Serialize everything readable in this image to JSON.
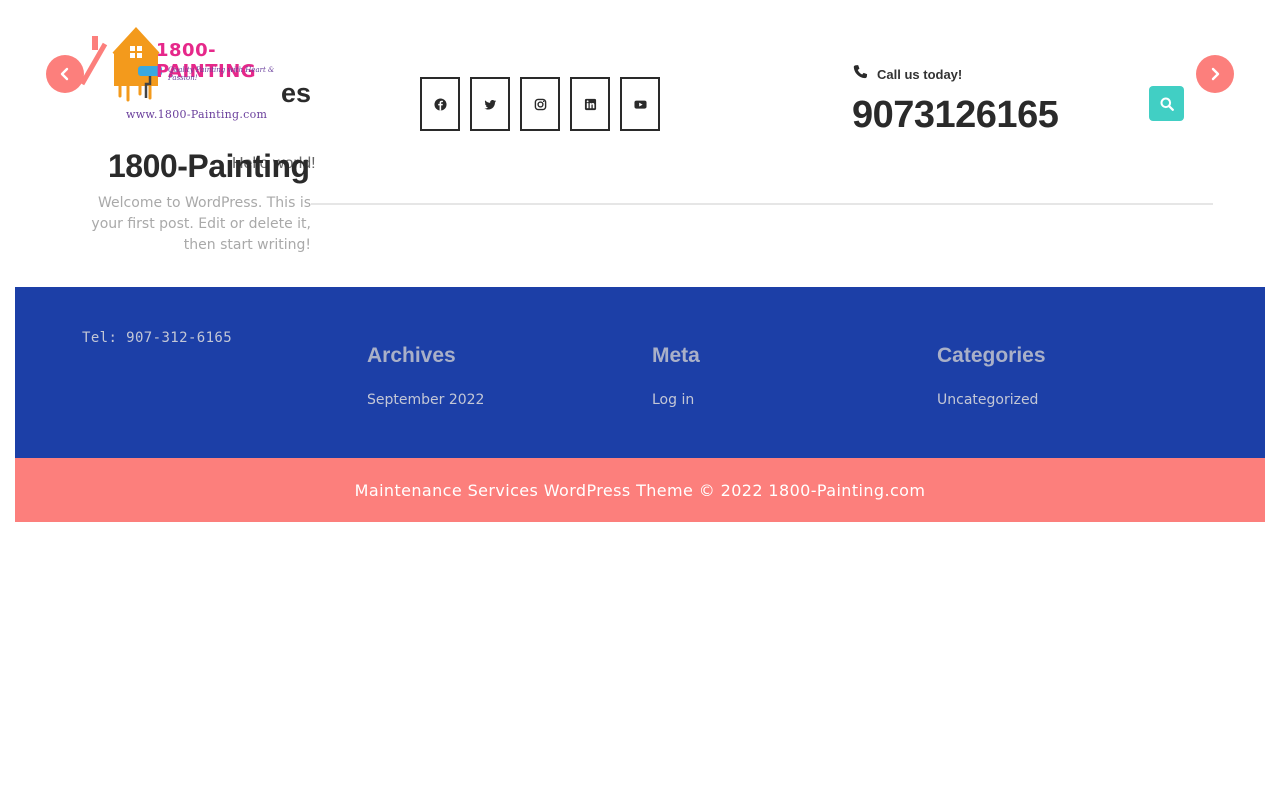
{
  "header": {
    "logo": {
      "brand": "1800-PAINTING",
      "tagline": "Quality Painting with Heart & Passion!",
      "url_text": "www.1800-Painting.com"
    },
    "overlap_heading_fragment": "es",
    "site_title": "1800-Painting",
    "post_title": "Hello world!",
    "post_excerpt": "Welcome to WordPress. This is your first post. Edit or delete it, then start writing!",
    "social_icons": [
      "facebook-icon",
      "twitter-icon",
      "instagram-icon",
      "linkedin-icon",
      "youtube-icon"
    ],
    "call_label": "Call us today!",
    "phone_number": "9073126165",
    "colors": {
      "accent_coral": "#fc7f7c",
      "accent_teal": "#41cfc4",
      "footer_blue": "#1c3fa7"
    }
  },
  "footer": {
    "tel": "Tel: 907-312-6165",
    "archives": {
      "title": "Archives",
      "links": [
        "September 2022"
      ]
    },
    "meta": {
      "title": "Meta",
      "links": [
        "Log in"
      ]
    },
    "categories": {
      "title": "Categories",
      "links": [
        "Uncategorized"
      ]
    }
  },
  "copyright": "Maintenance Services WordPress Theme © 2022 1800-Painting.com"
}
